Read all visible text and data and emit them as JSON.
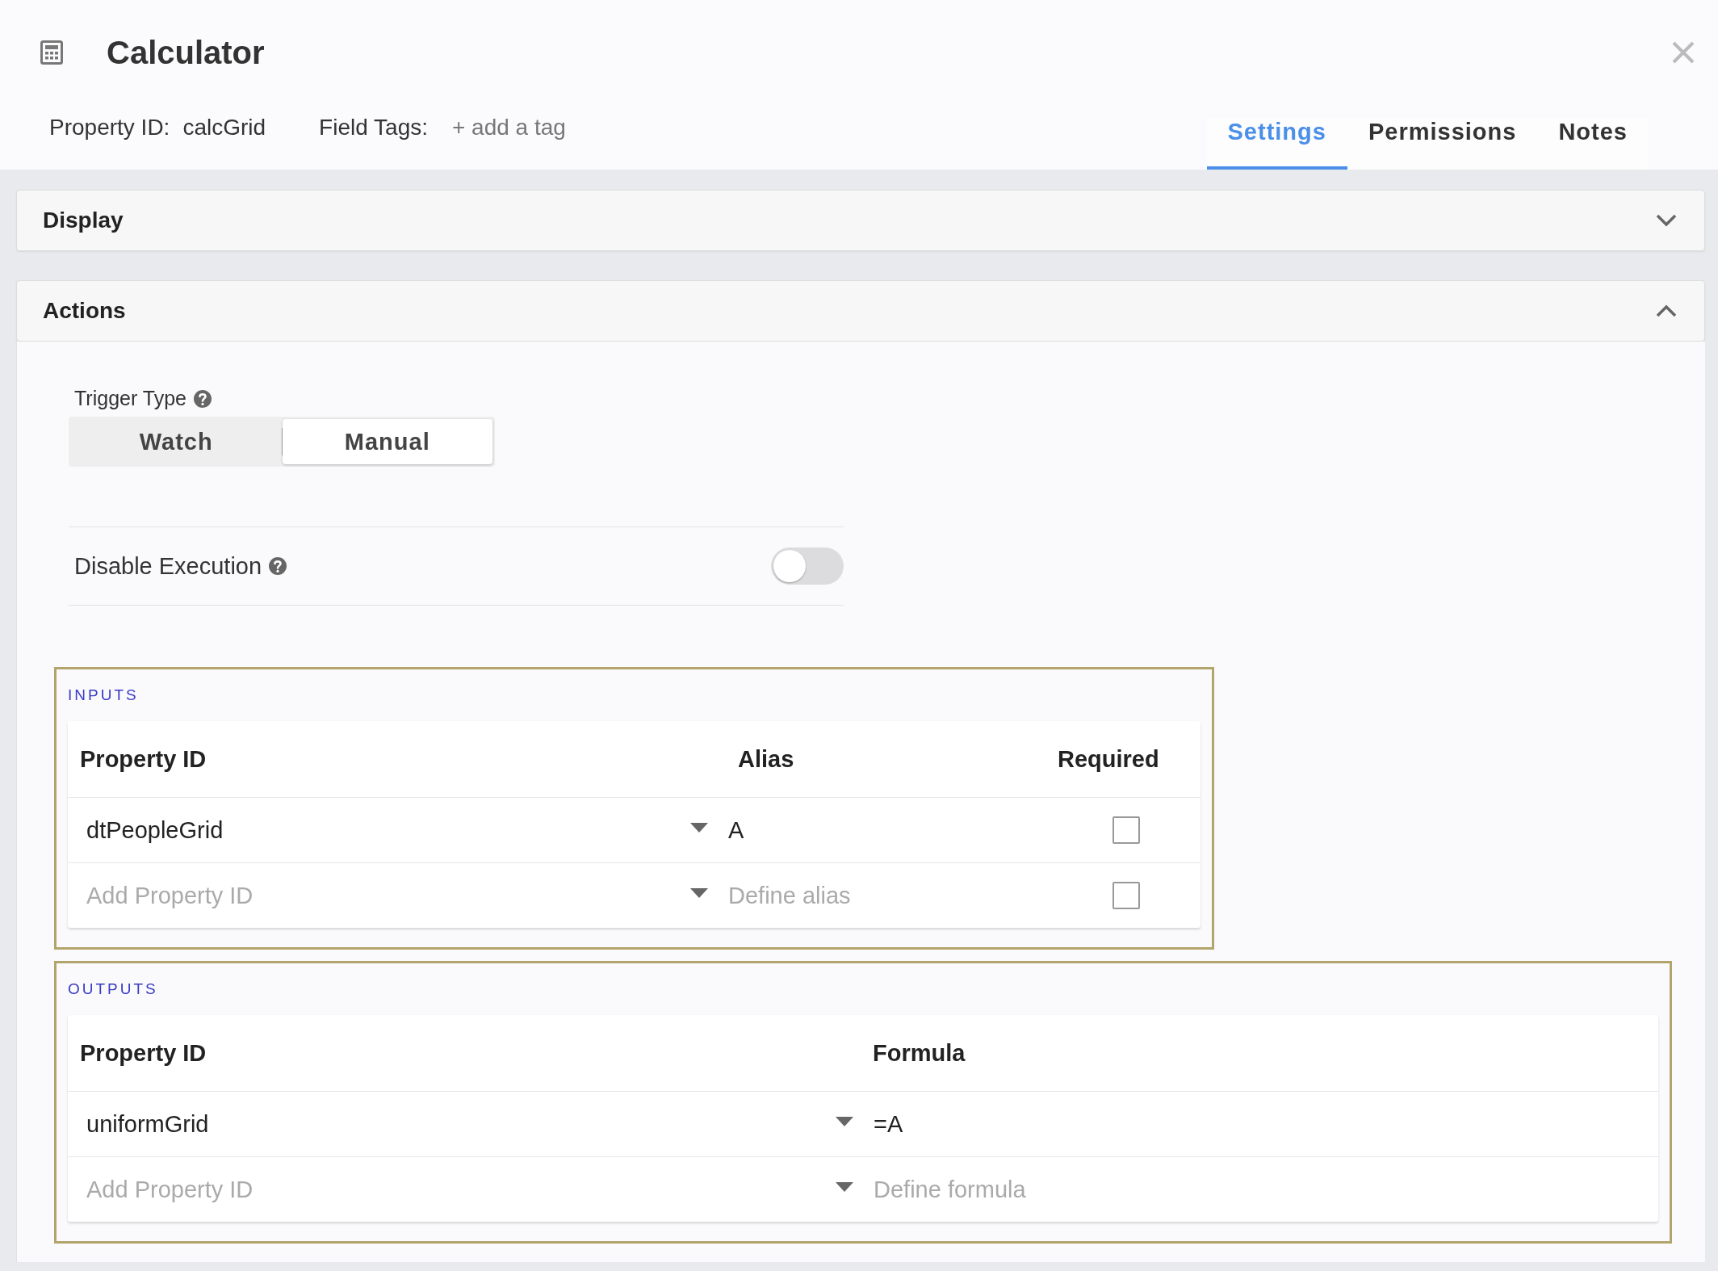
{
  "dialog": {
    "title": "Calculator",
    "property_id_label": "Property ID:",
    "property_id": "calcGrid",
    "field_tags_label": "Field Tags:",
    "add_tag": "+ add a tag"
  },
  "tabs": [
    {
      "label": "Settings",
      "selected": true
    },
    {
      "label": "Permissions",
      "selected": false
    },
    {
      "label": "Notes",
      "selected": false
    }
  ],
  "panels": [
    {
      "title": "Display",
      "expanded": false
    },
    {
      "title": "Actions",
      "expanded": true
    }
  ],
  "trigger_type": {
    "label": "Trigger Type",
    "options": [
      {
        "label": "Watch",
        "selected": false
      },
      {
        "label": "Manual",
        "selected": true
      }
    ]
  },
  "disable_execution": {
    "label": "Disable Execution",
    "on": false
  },
  "inputs": {
    "title": "INPUTS",
    "columns": [
      "Property ID",
      "Alias",
      "Required"
    ],
    "rows": [
      {
        "property_id": "dtPeopleGrid",
        "alias": "A",
        "required": false
      },
      {
        "property_id_placeholder": "Add Property ID",
        "alias_placeholder": "Define alias",
        "required": false
      }
    ]
  },
  "outputs": {
    "title": "OUTPUTS",
    "columns": [
      "Property ID",
      "Formula"
    ],
    "rows": [
      {
        "property_id": "uniformGrid",
        "formula": "=A"
      },
      {
        "property_id_placeholder": "Add Property ID",
        "formula_placeholder": "Define formula"
      }
    ]
  }
}
